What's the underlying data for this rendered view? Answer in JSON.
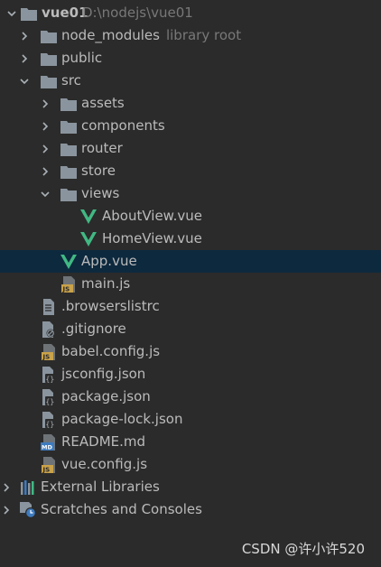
{
  "project": {
    "name": "vue01",
    "path": "D:\\nodejs\\vue01",
    "node_modules": {
      "label": "node_modules",
      "hint": "library root"
    },
    "public": "public",
    "src": {
      "label": "src",
      "assets": "assets",
      "components": "components",
      "router": "router",
      "store": "store",
      "views": {
        "label": "views",
        "about": "AboutView.vue",
        "home": "HomeView.vue"
      },
      "app": "App.vue",
      "main": "main.js"
    },
    "files": {
      "browserslistrc": ".browserslistrc",
      "gitignore": ".gitignore",
      "babel": "babel.config.js",
      "jsconfig": "jsconfig.json",
      "package": "package.json",
      "package_lock": "package-lock.json",
      "readme": "README.md",
      "vue_config": "vue.config.js"
    }
  },
  "external_libraries": "External Libraries",
  "scratches": "Scratches and Consoles",
  "watermark": "CSDN @许小许520",
  "colors": {
    "background": "#2b2b2b",
    "selection": "#0d293e",
    "folder": "#8a949e",
    "vue_green": "#41b883",
    "js_yellow": "#c9a24a",
    "hint": "#787878"
  }
}
